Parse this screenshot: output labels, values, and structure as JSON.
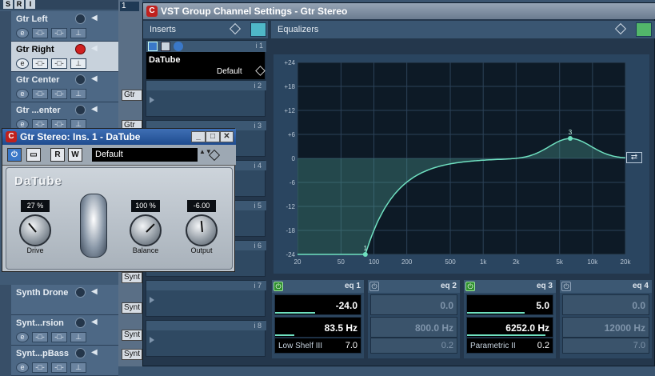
{
  "tracks": [
    {
      "name": "Gtr Left",
      "selected": false,
      "record": false,
      "show_controls": true
    },
    {
      "name": "Gtr Right",
      "selected": true,
      "record": true,
      "show_controls": true
    },
    {
      "name": "Gtr Center",
      "selected": false,
      "record": false,
      "show_controls": true
    },
    {
      "name": "Gtr ...enter",
      "selected": false,
      "record": false,
      "show_controls": true
    },
    {
      "name": "Synth Drone",
      "selected": false,
      "record": false,
      "show_controls": false
    },
    {
      "name": "Synt...rsion",
      "selected": false,
      "record": false,
      "show_controls": true
    },
    {
      "name": "Synt...pBass",
      "selected": false,
      "record": false,
      "show_controls": true
    }
  ],
  "track_header": {
    "btn_s": "S",
    "btn_r": "R",
    "btn_i": "I"
  },
  "arrange": {
    "ruler_marker": "1",
    "parts": [
      "Gtr",
      "Gtr",
      "Synt",
      "Synt",
      "Synt",
      "Synt"
    ]
  },
  "vst_window": {
    "title": "VST Group Channel Settings - Gtr Stereo",
    "inserts_label": "Inserts",
    "equalizers_label": "Equalizers",
    "insert_slots": [
      {
        "number": "i 1",
        "plugin": "DaTube",
        "preset": "Default"
      },
      {
        "number": "i 2",
        "plugin": "",
        "preset": ""
      },
      {
        "number": "i 3",
        "plugin": "",
        "preset": ""
      },
      {
        "number": "i 4",
        "plugin": "",
        "preset": ""
      },
      {
        "number": "i 5",
        "plugin": "",
        "preset": ""
      },
      {
        "number": "i 6",
        "plugin": "",
        "preset": ""
      },
      {
        "number": "i 7",
        "plugin": "",
        "preset": ""
      },
      {
        "number": "i 8",
        "plugin": "",
        "preset": ""
      }
    ],
    "eq_graph": {
      "y_labels": [
        "+24",
        "+18",
        "+12",
        "+6",
        "0",
        "-6",
        "-12",
        "-18",
        "-24"
      ],
      "x_labels": [
        "20",
        "50",
        "100",
        "200",
        "500",
        "1k",
        "2k",
        "5k",
        "10k",
        "20k"
      ],
      "point_labels": [
        "1",
        "3"
      ]
    },
    "eq_bands": [
      {
        "label": "eq 1",
        "active": true,
        "gain": "-24.0",
        "freq": "83.5 Hz",
        "type": "Low Shelf III",
        "q": "7.0"
      },
      {
        "label": "eq 2",
        "active": false,
        "gain": "0.0",
        "freq": "800.0 Hz",
        "type": "",
        "q": "0.2"
      },
      {
        "label": "eq 3",
        "active": true,
        "gain": "5.0",
        "freq": "6252.0 Hz",
        "type": "Parametric II",
        "q": "0.2"
      },
      {
        "label": "eq 4",
        "active": false,
        "gain": "0.0",
        "freq": "12000 Hz",
        "type": "",
        "q": "7.0"
      }
    ]
  },
  "plugin_window": {
    "title": "Gtr Stereo: Ins. 1 - DaTube",
    "preset": "Default",
    "btn_r": "R",
    "btn_w": "W",
    "logo": "DaTube",
    "knobs": [
      {
        "label": "Drive",
        "display": "27 %"
      },
      {
        "label": "Balance",
        "display": "100 %"
      },
      {
        "label": "Output",
        "display": "-6.00"
      }
    ]
  },
  "colors": {
    "accent_green": "#2e8f2e",
    "eq_curve": "#6fe0c0",
    "title_red": "#c0211e"
  }
}
